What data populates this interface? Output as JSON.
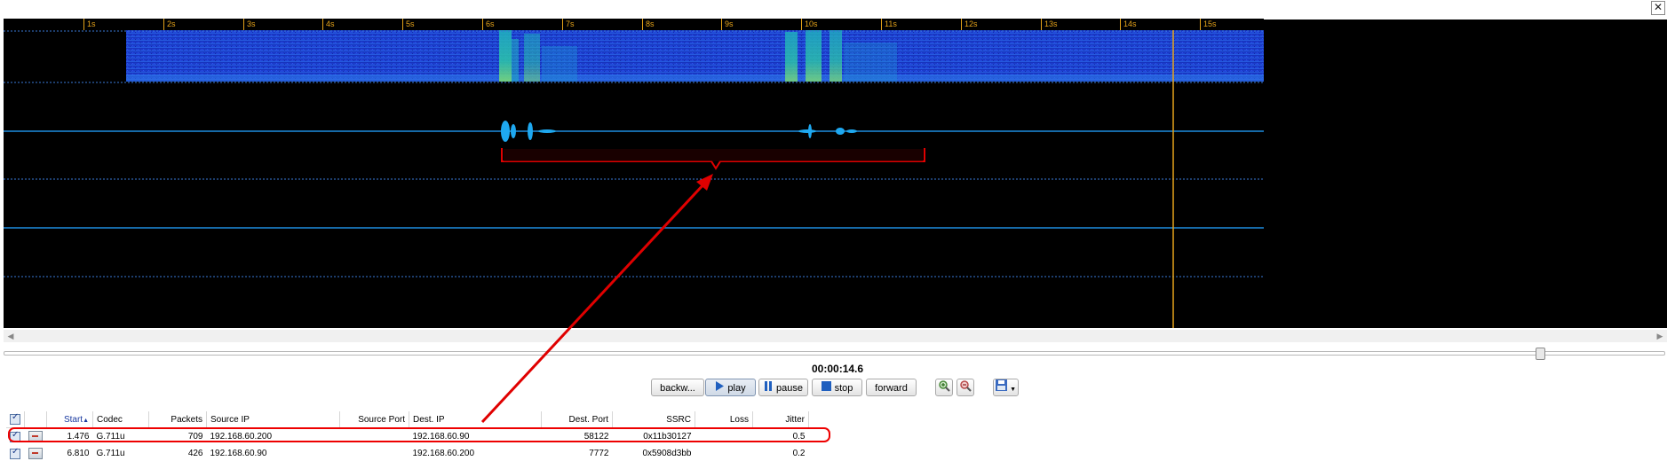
{
  "window": {
    "close_label": "✕"
  },
  "ruler": {
    "ticks": [
      "1s",
      "2s",
      "3s",
      "4s",
      "5s",
      "6s",
      "7s",
      "8s",
      "9s",
      "10s",
      "11s",
      "12s",
      "13s",
      "14s",
      "15s"
    ]
  },
  "playback": {
    "time": "00:00:14.6",
    "backward_label": "backw...",
    "play_label": "play",
    "pause_label": "pause",
    "stop_label": "stop",
    "forward_label": "forward",
    "zoom_in_icon": "zoom-in-icon",
    "zoom_out_icon": "zoom-out-icon",
    "save_icon": "save-icon"
  },
  "table": {
    "columns": [
      "Start",
      "Codec",
      "Packets",
      "Source IP",
      "Source Port",
      "Dest. IP",
      "Dest. Port",
      "SSRC",
      "Loss",
      "Jitter"
    ],
    "rows": [
      {
        "start": "1.476",
        "codec": "G.711u",
        "packets": "709",
        "source_ip": "192.168.60.200",
        "source_port": "",
        "dest_ip": "192.168.60.90",
        "dest_port": "58122",
        "ssrc": "0x11b30127",
        "loss": "",
        "jitter": "0.5"
      },
      {
        "start": "6.810",
        "codec": "G.711u",
        "packets": "426",
        "source_ip": "192.168.60.90",
        "source_port": "",
        "dest_ip": "192.168.60.200",
        "dest_port": "7772",
        "ssrc": "0x5908d3bb",
        "loss": "",
        "jitter": "0.2"
      }
    ]
  },
  "colors": {
    "spectrogram": "#1f3fd0",
    "waveform": "#1e90ff",
    "ruler": "#e5a31a",
    "annotation": "#e00000"
  }
}
